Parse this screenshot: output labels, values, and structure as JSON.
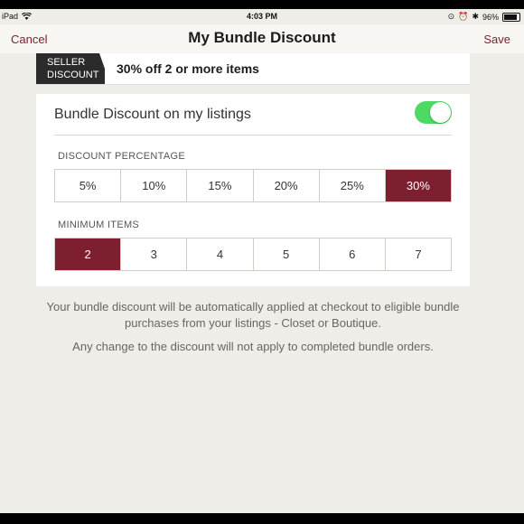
{
  "status_bar": {
    "device": "iPad",
    "wifi_icon": "wifi-icon",
    "time": "4:03 PM",
    "battery": "96%"
  },
  "nav": {
    "cancel": "Cancel",
    "title": "My Bundle Discount",
    "save": "Save"
  },
  "banner": {
    "tag_line1": "SELLER",
    "tag_line2": "DISCOUNT",
    "text": "30% off 2 or more items"
  },
  "panel": {
    "toggle_label": "Bundle Discount on my listings",
    "toggle_on": true,
    "discount_label": "DISCOUNT PERCENTAGE",
    "discount_options": [
      "5%",
      "10%",
      "15%",
      "20%",
      "25%",
      "30%"
    ],
    "discount_selected": "30%",
    "min_items_label": "MINIMUM ITEMS",
    "min_items_options": [
      "2",
      "3",
      "4",
      "5",
      "6",
      "7"
    ],
    "min_items_selected": "2"
  },
  "info": {
    "line1": "Your bundle discount will be automatically applied at checkout to eligible bundle purchases from your listings - Closet or Boutique.",
    "line2": "Any change to the discount will not apply to completed bundle orders."
  },
  "colors": {
    "accent": "#7d1f2e",
    "toggle_on": "#4cd964",
    "background": "#efede8"
  }
}
